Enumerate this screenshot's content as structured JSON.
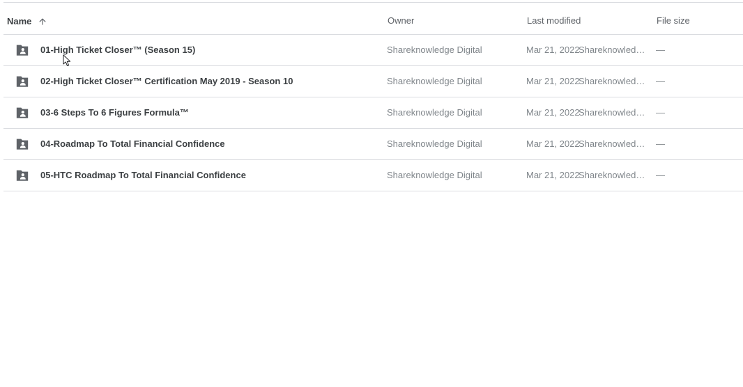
{
  "header": {
    "name": "Name",
    "owner": "Owner",
    "last_modified": "Last modified",
    "file_size": "File size",
    "sort_icon": "arrow-up-icon"
  },
  "files": [
    {
      "name": "01-High Ticket Closer™ (Season 15)",
      "owner": "Shareknowledge Digital",
      "date": "Mar 21, 2022",
      "modified_by": "Shareknowledge Digital",
      "size": "—",
      "icon": "shared-folder-icon"
    },
    {
      "name": "02-High Ticket Closer™ Certification May 2019 - Season 10",
      "owner": "Shareknowledge Digital",
      "date": "Mar 21, 2022",
      "modified_by": "Shareknowledge Digital",
      "size": "—",
      "icon": "shared-folder-icon"
    },
    {
      "name": "03-6 Steps To 6 Figures Formula™",
      "owner": "Shareknowledge Digital",
      "date": "Mar 21, 2022",
      "modified_by": "Shareknowledge Digital",
      "size": "—",
      "icon": "shared-folder-icon"
    },
    {
      "name": "04-Roadmap To Total Financial Confidence",
      "owner": "Shareknowledge Digital",
      "date": "Mar 21, 2022",
      "modified_by": "Shareknowledge Digital",
      "size": "—",
      "icon": "shared-folder-icon"
    },
    {
      "name": "05-HTC Roadmap To Total Financial Confidence",
      "owner": "Shareknowledge Digital",
      "date": "Mar 21, 2022",
      "modified_by": "Shareknowledge Digital",
      "size": "—",
      "icon": "shared-folder-icon"
    }
  ],
  "colors": {
    "icon": "#5f6368",
    "text_primary": "#3c4043",
    "text_secondary": "#80868b",
    "divider": "#dadce0"
  }
}
